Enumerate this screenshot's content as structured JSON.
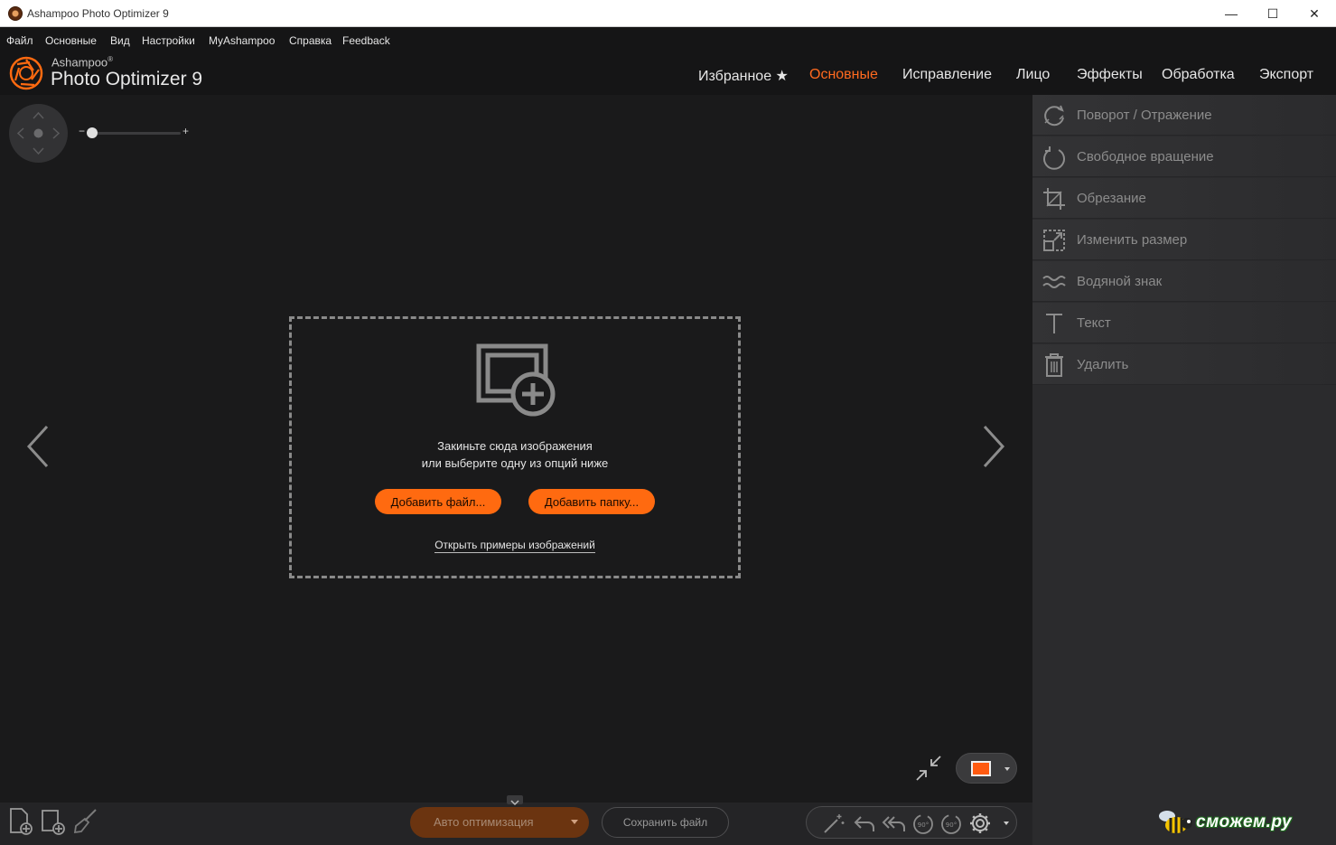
{
  "window": {
    "title": "Ashampoo Photo Optimizer 9",
    "controls": {
      "minimize": "—",
      "maximize": "☐",
      "close": "✕"
    }
  },
  "menu": {
    "items": [
      "Файл",
      "Основные",
      "Вид",
      "Настройки",
      "MyAshampoo",
      "Справка",
      "Feedback"
    ]
  },
  "brand": {
    "small": "Ashampoo",
    "reg": "®",
    "big": "Photo Optimizer 9"
  },
  "tabs": [
    {
      "label": "Избранное ★",
      "active": false
    },
    {
      "label": "Основные",
      "active": true
    },
    {
      "label": "Исправление",
      "active": false
    },
    {
      "label": "Лицо",
      "active": false
    },
    {
      "label": "Эффекты",
      "active": false
    },
    {
      "label": "Обработка",
      "active": false
    },
    {
      "label": "Экспорт",
      "active": false
    }
  ],
  "zoom": {
    "minus": "−",
    "plus": "+",
    "level_fraction": 0.0
  },
  "dropzone": {
    "line1": "Закиньте сюда изображения",
    "line2": "или выберите одну из опций ниже",
    "add_file": "Добавить файл...",
    "add_folder": "Добавить папку...",
    "open_samples": "Открыть примеры изображений"
  },
  "sidebar": {
    "items": [
      {
        "label": "Поворот / Отражение",
        "icon": "rotate-flip-icon"
      },
      {
        "label": "Свободное вращение",
        "icon": "free-rotate-icon"
      },
      {
        "label": "Обрезание",
        "icon": "crop-icon"
      },
      {
        "label": "Изменить размер",
        "icon": "resize-icon"
      },
      {
        "label": "Водяной знак",
        "icon": "watermark-icon"
      },
      {
        "label": "Текст",
        "icon": "text-icon"
      },
      {
        "label": "Удалить",
        "icon": "trash-icon"
      }
    ]
  },
  "bottom": {
    "auto_optimize": "Авто оптимизация",
    "save_file": "Сохранить файл",
    "rotate_left_label": "90°",
    "rotate_right_label": "90°"
  },
  "watermark": {
    "text": "сможем.ру"
  },
  "colors": {
    "accent": "#ff6a10",
    "active_tab": "#ff6a1f",
    "background": "#1a1a1b",
    "panel": "#2b2b2d"
  }
}
